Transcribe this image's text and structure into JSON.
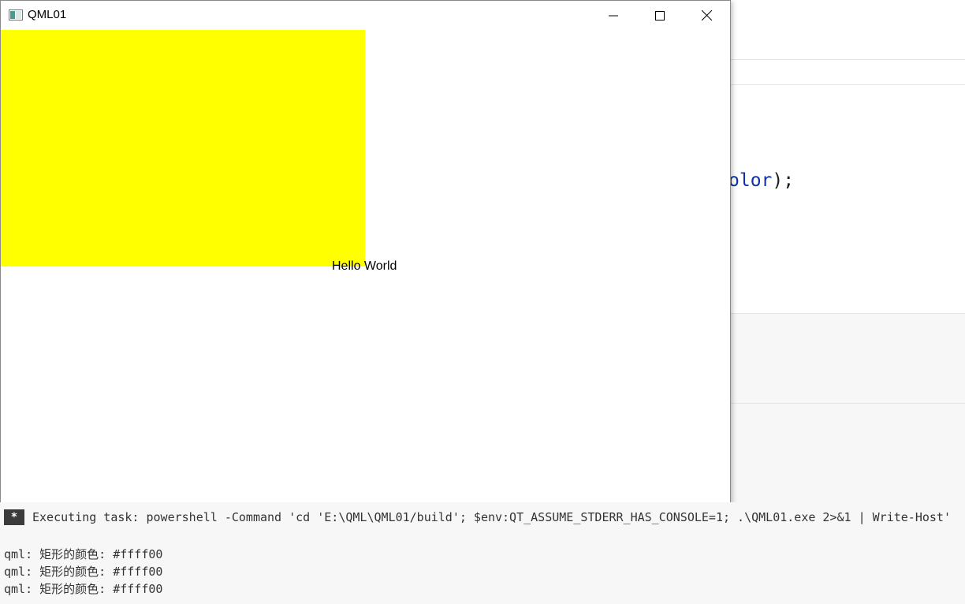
{
  "window": {
    "title": "QML01",
    "content": {
      "rect_color": "#ffff00",
      "text": "Hello World"
    }
  },
  "editor": {
    "code_fragment_ident": "olor",
    "code_fragment_punct": ");"
  },
  "terminal": {
    "task_badge": "*",
    "task_line": "Executing task: powershell -Command 'cd 'E:\\QML\\QML01/build'; $env:QT_ASSUME_STDERR_HAS_CONSOLE=1; .\\QML01.exe 2>&1 | Write-Host'",
    "output": [
      "qml: 矩形的颜色: #ffff00",
      "qml: 矩形的颜色: #ffff00",
      "qml: 矩形的颜色: #ffff00"
    ]
  }
}
